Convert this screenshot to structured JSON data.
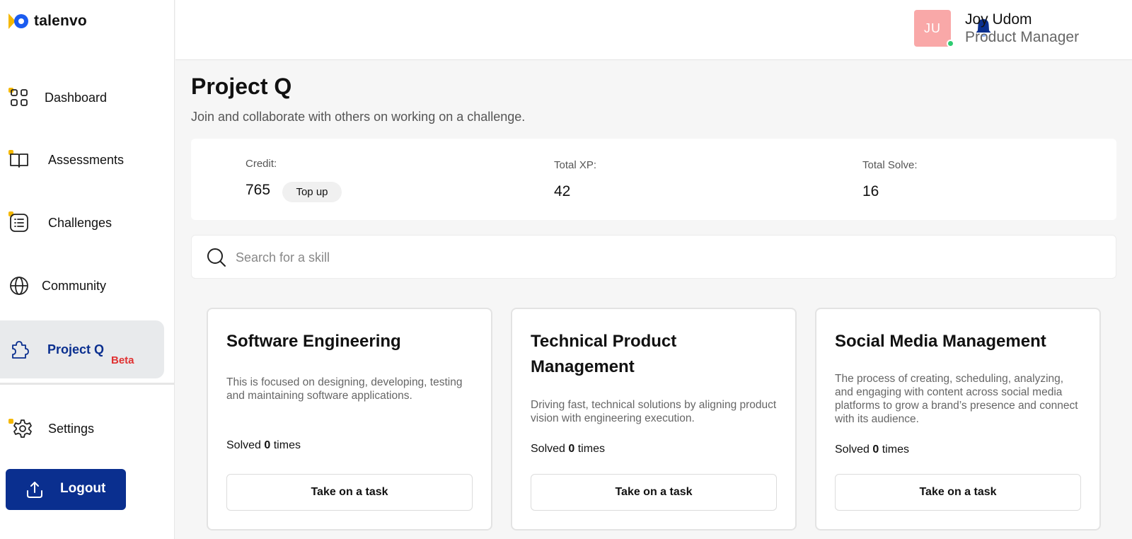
{
  "app": {
    "brand": "talenvo"
  },
  "sidebar": {
    "items": [
      {
        "label": "Dashboard",
        "icon": "grid-icon"
      },
      {
        "label": "Assessments",
        "icon": "book-open-icon"
      },
      {
        "label": "Challenges",
        "icon": "list-icon"
      },
      {
        "label": "Community",
        "icon": "globe-icon"
      },
      {
        "label": "Project Q",
        "icon": "puzzle-icon",
        "badge": "Beta",
        "active": true
      },
      {
        "label": "Settings",
        "icon": "gear-icon"
      }
    ],
    "logout_label": "Logout"
  },
  "header": {
    "user": {
      "initials": "JU",
      "name": "Joy Udom",
      "role": "Product Manager",
      "status": "online"
    }
  },
  "page": {
    "title": "Project Q",
    "subtitle": "Join and collaborate with others on working on a challenge."
  },
  "stats": {
    "credit_label": "Credit:",
    "credit_value": "765",
    "topup_label": "Top up",
    "xp_label": "Total XP:",
    "xp_value": "42",
    "solve_label": "Total Solve:",
    "solve_value": "16"
  },
  "search": {
    "placeholder": "Search for a skill",
    "value": ""
  },
  "cards": [
    {
      "title": "Software Engineering",
      "description": "This is focused on designing, developing, testing and maintaining software applications.",
      "solved_prefix": "Solved",
      "solved_count": "0",
      "solved_suffix": "times",
      "button_label": "Take on a task"
    },
    {
      "title": "Technical Product Management",
      "description": "Driving fast, technical solutions by aligning product vision with engineering execution.",
      "solved_prefix": "Solved",
      "solved_count": "0",
      "solved_suffix": "times",
      "button_label": "Take on a task"
    },
    {
      "title": "Social Media Management",
      "description": "The process of creating, scheduling, analyzing, and engaging with content across social media platforms to grow a brand’s presence and connect with its audience.",
      "solved_prefix": "Solved",
      "solved_count": "0",
      "solved_suffix": "times",
      "button_label": "Take on a task"
    }
  ],
  "colors": {
    "primary": "#0a2f8f",
    "accent_dot": "#f5b800",
    "beta": "#e03131",
    "avatar_bg": "#f9a8a8",
    "online": "#2ecc71"
  }
}
